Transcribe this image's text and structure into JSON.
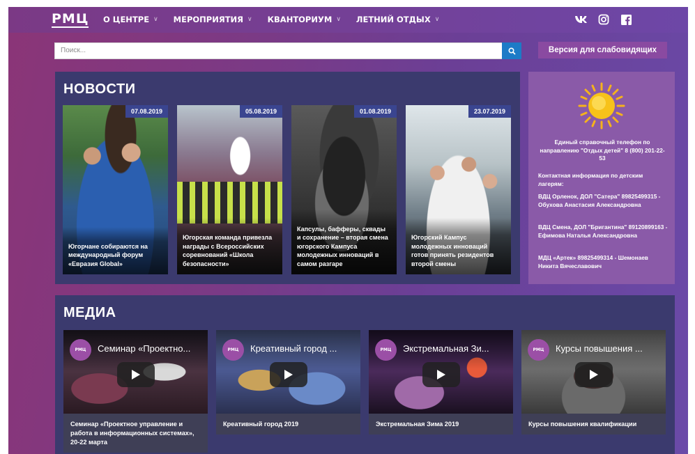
{
  "header": {
    "logo": "РМЦ",
    "menu": [
      {
        "label": "О ЦЕНТРЕ"
      },
      {
        "label": "МЕРОПРИЯТИЯ"
      },
      {
        "label": "КВАНТОРИУМ"
      },
      {
        "label": "ЛЕТНИЙ ОТДЫХ"
      }
    ],
    "social_icons": [
      "vk-icon",
      "instagram-icon",
      "facebook-icon"
    ]
  },
  "search": {
    "placeholder": "Поиск...",
    "button_icon": "search-icon"
  },
  "vision_button": "Версия для слабовидящих",
  "news": {
    "title": "НОВОСТИ",
    "items": [
      {
        "date": "07.08.2019",
        "caption": "Югорчане собираются на международный форум «Евразия Global»"
      },
      {
        "date": "05.08.2019",
        "caption": "Югорская команда привезла награды с Всероссийских соревнований «Школа безопасности»"
      },
      {
        "date": "01.08.2019",
        "caption": "Капсулы, бафферы, сквады и сохранение – вторая смена югорского Кампуса молодежных инноваций в самом разгаре"
      },
      {
        "date": "23.07.2019",
        "caption": "Югорский Кампус молодежных инноваций готов принять резидентов второй смены"
      }
    ]
  },
  "info": {
    "icon": "sun-icon",
    "hotline": "Единый справочный телефон по направлению \"Отдых детей\" 8 (800) 201-22-53",
    "contacts_heading": "Контактная информация по детским лагерям:",
    "contacts": [
      "ВДЦ Орленок, ДОЛ \"Сатера\" 89825499315 - Обухова Анастасия Александровна",
      "ВДЦ Смена, ДОЛ \"Бригантина\" 89120899163 - Ефимова Наталья Александровна",
      "МДЦ «Артек» 89825499314 - Шемонаев Никита Вячеславович"
    ]
  },
  "media": {
    "title": "МЕДИА",
    "channel_logo": "РМЦ",
    "videos": [
      {
        "thumb_title": "Семинар «Проектно...",
        "caption": "Семинар «Проектное управление и работа в информационных системах», 20-22 марта"
      },
      {
        "thumb_title": "Креативный город ...",
        "caption": "Креативный город 2019"
      },
      {
        "thumb_title": "Экстремальная Зи...",
        "caption": "Экстремальная Зима 2019"
      },
      {
        "thumb_title": "Курсы повышения ...",
        "caption": "Курсы повышения квалификации"
      }
    ]
  },
  "colors": {
    "nav_bg": "#744096",
    "panel_bg": "#3b3a6e",
    "info_bg": "#8a5aa8",
    "search_button": "#1d7bc7",
    "date_badge": "#3a4590"
  }
}
